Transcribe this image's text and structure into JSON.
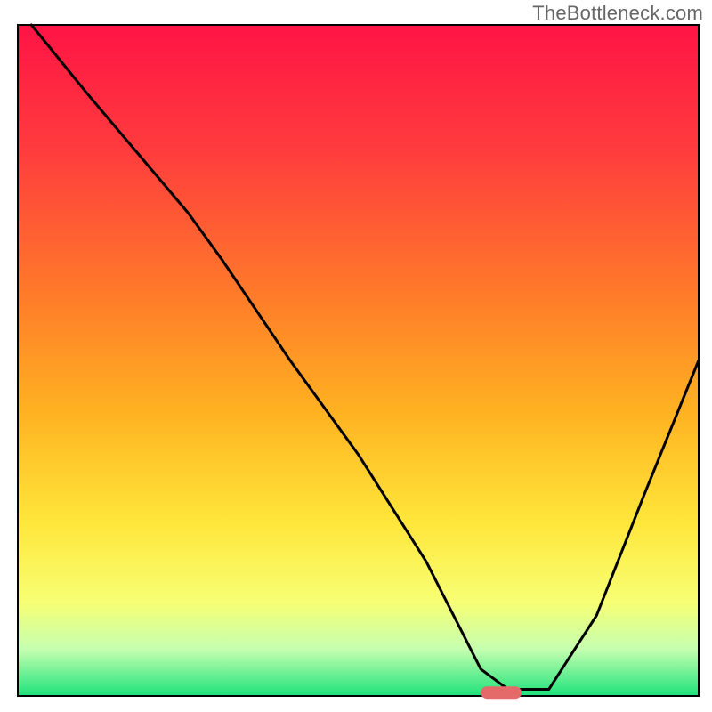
{
  "watermark": "TheBottleneck.com",
  "chart_data": {
    "type": "line",
    "title": "",
    "xlabel": "",
    "ylabel": "",
    "xlim": [
      0,
      100
    ],
    "ylim": [
      0,
      100
    ],
    "x": [
      2,
      10,
      20,
      25,
      30,
      40,
      50,
      60,
      65,
      68,
      72,
      78,
      85,
      92,
      100
    ],
    "y": [
      100,
      90,
      78,
      72,
      65,
      50,
      36,
      20,
      10,
      4,
      1,
      1,
      12,
      30,
      50
    ],
    "marker": {
      "x_start": 68,
      "x_end": 74,
      "y": 0.5
    },
    "gradient_stops": [
      {
        "pct": 0,
        "color": "#ff1444"
      },
      {
        "pct": 18,
        "color": "#ff3a3e"
      },
      {
        "pct": 40,
        "color": "#ff7a2a"
      },
      {
        "pct": 58,
        "color": "#ffb321"
      },
      {
        "pct": 74,
        "color": "#ffe63a"
      },
      {
        "pct": 86,
        "color": "#f7ff74"
      },
      {
        "pct": 93,
        "color": "#c6ffb0"
      },
      {
        "pct": 100,
        "color": "#1de27a"
      }
    ]
  }
}
